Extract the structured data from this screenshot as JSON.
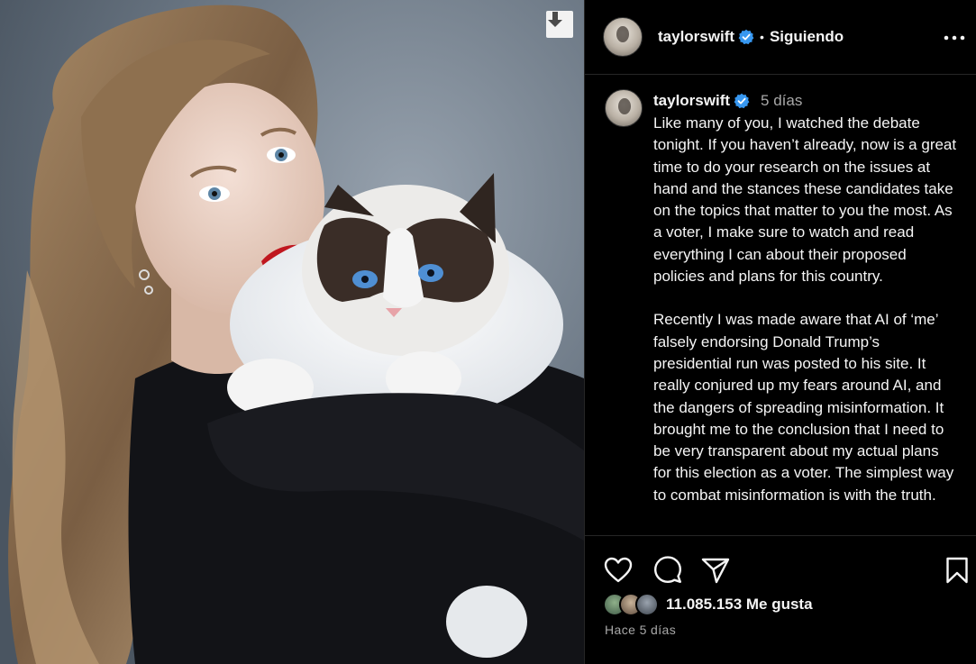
{
  "post": {
    "author": "taylorswift",
    "follow_state": "Siguiendo",
    "separator": "•",
    "caption_time": "5 días",
    "caption_paragraphs": [
      "Like many of you, I watched the debate tonight. If you haven’t already, now is a great time to do your research on the issues at hand and the stances these candidates take on the topics that matter to you the most. As a voter, I make sure to watch and read everything I can about their proposed policies and plans for this country.",
      "Recently I was made aware that AI of ‘me’ falsely endorsing Donald Trump’s presidential run was posted to his site. It really conjured up my fears around AI, and the dangers of spreading misinformation. It brought me to the conclusion that I need to be very transparent about my actual plans for this election as a voter. The simplest way to combat misinformation is with the truth."
    ],
    "likes": "11.085.153 Me gusta",
    "timestamp": "Hace 5 días"
  },
  "icons": {
    "download": "download-arrow-icon",
    "verified": "verified-badge-icon",
    "more": "more-options-icon",
    "like": "heart-icon",
    "comment": "comment-icon",
    "share": "paper-plane-icon",
    "save": "bookmark-icon"
  },
  "colors": {
    "background": "#000000",
    "text": "#f5f5f5",
    "secondary_text": "#a8a8a8",
    "verified_blue": "#3797f0",
    "divider": "#262626"
  }
}
